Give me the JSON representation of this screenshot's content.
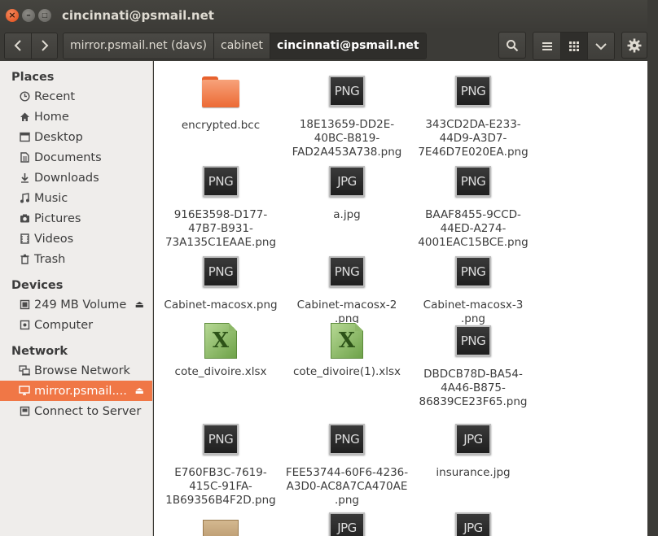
{
  "window": {
    "title": "cincinnati@psmail.net",
    "close_glyph": "×",
    "min_glyph": "–",
    "max_glyph": "□"
  },
  "toolbar": {
    "back_glyph": "‹",
    "forward_glyph": "›",
    "breadcrumbs": [
      "mirror.psmail.net (davs)",
      "cabinet",
      "cincinnati@psmail.net"
    ],
    "search_icon": "search-icon",
    "list_icon": "list-view-icon",
    "grid_icon": "grid-view-icon",
    "menu_icon": "chevron-down-icon",
    "settings_icon": "gear-icon"
  },
  "sidebar": {
    "places_label": "Places",
    "places": [
      {
        "label": "Recent",
        "icon": "clock-icon"
      },
      {
        "label": "Home",
        "icon": "home-icon"
      },
      {
        "label": "Desktop",
        "icon": "desktop-folder-icon"
      },
      {
        "label": "Documents",
        "icon": "documents-icon"
      },
      {
        "label": "Downloads",
        "icon": "downloads-icon"
      },
      {
        "label": "Music",
        "icon": "music-icon"
      },
      {
        "label": "Pictures",
        "icon": "camera-icon"
      },
      {
        "label": "Videos",
        "icon": "film-icon"
      },
      {
        "label": "Trash",
        "icon": "trash-icon"
      }
    ],
    "devices_label": "Devices",
    "devices": [
      {
        "label": "249 MB Volume",
        "icon": "drive-icon",
        "eject": true
      },
      {
        "label": "Computer",
        "icon": "computer-icon",
        "eject": false
      }
    ],
    "network_label": "Network",
    "network": [
      {
        "label": "Browse Network",
        "icon": "network-icon",
        "selected": false,
        "eject": false
      },
      {
        "label": "mirror.psmail....",
        "icon": "network-folder-icon",
        "selected": true,
        "eject": true
      },
      {
        "label": "Connect to Server",
        "icon": "server-icon",
        "selected": false,
        "eject": false
      }
    ],
    "eject_glyph": "⏏",
    "selected_color": "#f07746"
  },
  "files": [
    {
      "name": "encrypted.bcc",
      "type": "folder"
    },
    {
      "name": "18E13659-DD2E-40BC-B819-FAD2A453A738.png",
      "type": "image",
      "badge": "PNG"
    },
    {
      "name": "343CD2DA-E233-44D9-A3D7-7E46D7E020EA.png",
      "type": "image",
      "badge": "PNG"
    },
    {
      "name": "916E3598-D177-47B7-B931-73A135C1EAAE.png",
      "type": "image",
      "badge": "PNG"
    },
    {
      "name": "a.jpg",
      "type": "image",
      "badge": "JPG"
    },
    {
      "name": "BAAF8455-9CCD-44ED-A274-4001EAC15BCE.png",
      "type": "image",
      "badge": "PNG"
    },
    {
      "name": "Cabinet-macosx.png",
      "type": "image",
      "badge": "PNG"
    },
    {
      "name": "Cabinet-macosx-2.png",
      "type": "image",
      "badge": "PNG"
    },
    {
      "name": "Cabinet-macosx-3.png",
      "type": "image",
      "badge": "PNG"
    },
    {
      "name": "cote_divoire.xlsx",
      "type": "spreadsheet",
      "badge": "X"
    },
    {
      "name": "cote_divoire(1).xlsx",
      "type": "spreadsheet",
      "badge": "X"
    },
    {
      "name": "DBDCB78D-BA54-4A46-B875-86839CE23F65.png",
      "type": "image",
      "badge": "PNG"
    },
    {
      "name": "E760FB3C-7619-415C-91FA-1B69356B4F2D.png",
      "type": "image",
      "badge": "PNG"
    },
    {
      "name": "FEE53744-60F6-4236-A3D0-AC8A7CA470AE.png",
      "type": "image",
      "badge": "PNG"
    },
    {
      "name": "insurance.jpg",
      "type": "image",
      "badge": "JPG"
    },
    {
      "name": "",
      "type": "archive"
    },
    {
      "name": "",
      "type": "image",
      "badge": "JPG"
    },
    {
      "name": "",
      "type": "image",
      "badge": "JPG"
    }
  ]
}
